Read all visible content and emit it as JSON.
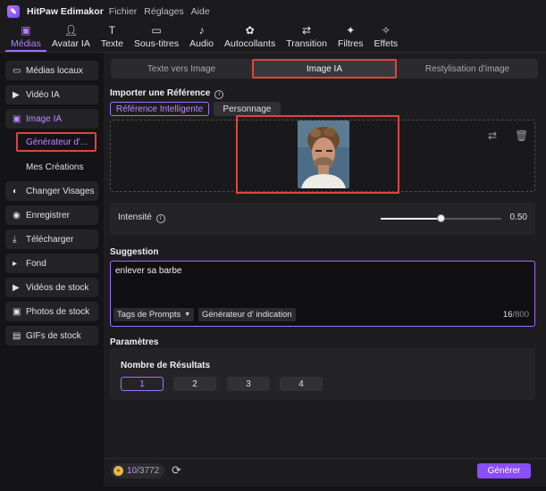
{
  "app": {
    "title": "HitPaw Edimakor"
  },
  "menu": [
    "Fichier",
    "Réglages",
    "Aide"
  ],
  "toolbar": [
    {
      "label": "Médias",
      "icon": "media-icon",
      "glyph": "▣",
      "active": true
    },
    {
      "label": "Avatar IA",
      "icon": "avatar-icon",
      "glyph": "👤︎",
      "active": false
    },
    {
      "label": "Texte",
      "icon": "text-icon",
      "glyph": "T",
      "active": false
    },
    {
      "label": "Sous-titres",
      "icon": "subtitles-icon",
      "glyph": "▭",
      "active": false
    },
    {
      "label": "Audio",
      "icon": "audio-icon",
      "glyph": "♪",
      "active": false
    },
    {
      "label": "Autocollants",
      "icon": "stickers-icon",
      "glyph": "✿",
      "active": false
    },
    {
      "label": "Transition",
      "icon": "transition-icon",
      "glyph": "⇄",
      "active": false
    },
    {
      "label": "Filtres",
      "icon": "filters-icon",
      "glyph": "✦",
      "active": false
    },
    {
      "label": "Effets",
      "icon": "effects-icon",
      "glyph": "✧",
      "active": false
    }
  ],
  "sidebar": {
    "items": [
      {
        "label": "Médias locaux",
        "icon": "folder-icon",
        "glyph": "▭"
      },
      {
        "label": "Vidéo IA",
        "icon": "video-ai-icon",
        "glyph": "▶"
      },
      {
        "label": "Image IA",
        "icon": "image-ai-icon",
        "glyph": "▣"
      },
      {
        "label": "Changer Visages",
        "icon": "face-swap-icon",
        "glyph": "◐"
      },
      {
        "label": "Enregistrer",
        "icon": "record-icon",
        "glyph": "◉"
      },
      {
        "label": "Télécharger",
        "icon": "download-icon",
        "glyph": "⤓"
      },
      {
        "label": "Fond",
        "icon": "background-icon",
        "glyph": "▸"
      },
      {
        "label": "Vidéos de stock",
        "icon": "stock-video-icon",
        "glyph": "▶"
      },
      {
        "label": "Photos de stock",
        "icon": "stock-photo-icon",
        "glyph": "▣"
      },
      {
        "label": "GIFs de stock",
        "icon": "stock-gif-icon",
        "glyph": "▤"
      }
    ],
    "sub_items": [
      "Générateur d'...",
      "Mes Créations"
    ]
  },
  "tabs": [
    "Texte vers Image",
    "Image IA",
    "Restylisation d'image"
  ],
  "reference": {
    "title": "Importer une Référence",
    "subtabs": [
      "Référence Intelligente",
      "Personnage"
    ]
  },
  "intensity": {
    "label": "Intensité",
    "value": "0.50",
    "fraction": 0.5
  },
  "suggestion": {
    "title": "Suggestion",
    "text": "enlever sa barbe",
    "tags_button": "Tags de Prompts",
    "indication_button": "Générateur d'  indication",
    "count": "16",
    "max": "/800"
  },
  "params": {
    "title": "Paramètres",
    "results_label": "Nombre de Résultats",
    "options": [
      "1",
      "2",
      "3",
      "4"
    ],
    "selected": "1"
  },
  "footer": {
    "credits_used": "10",
    "credits_total": "/3772",
    "generate": "Générer"
  }
}
